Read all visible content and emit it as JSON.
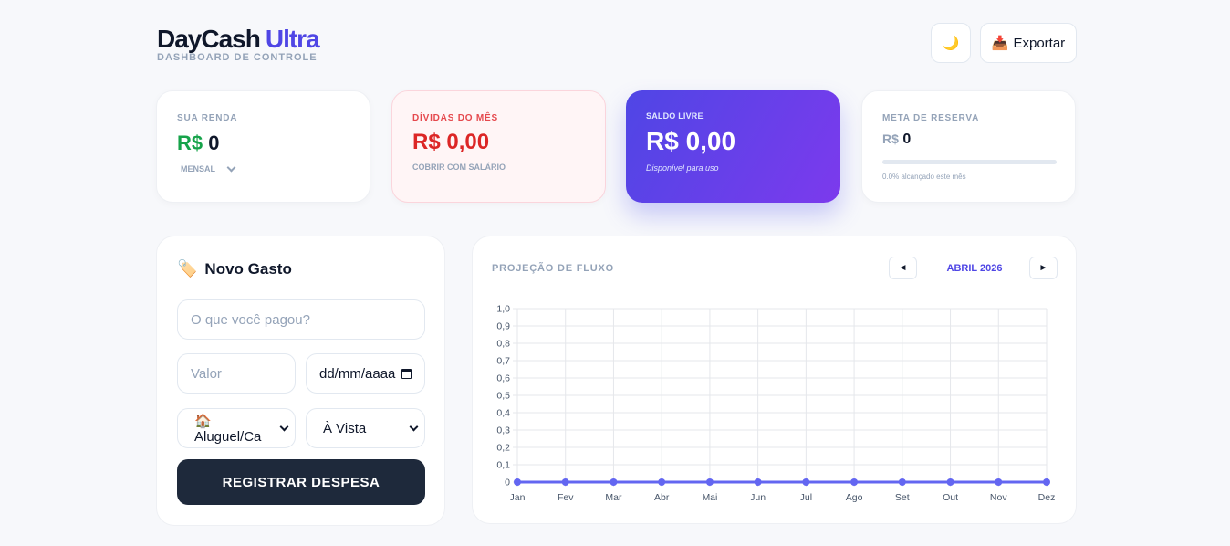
{
  "header": {
    "brand_main": "DayCash",
    "brand_accent": "Ultra",
    "subtitle": "DASHBOARD DE CONTROLE",
    "theme_icon": "🌙",
    "export_icon": "📥",
    "export_label": "Exportar"
  },
  "cards": {
    "renda": {
      "label": "SUA RENDA",
      "currency": "R$",
      "value": "0",
      "frequency": "MENSAL"
    },
    "dividas": {
      "label": "DÍVIDAS DO MÊS",
      "value": "R$ 0,00",
      "note": "COBRIR COM SALÁRIO"
    },
    "saldo": {
      "label": "SALDO LIVRE",
      "value": "R$ 0,00",
      "note": "Disponível para uso"
    },
    "meta": {
      "label": "META DE RESERVA",
      "currency": "R$",
      "value": "0",
      "progress_pct": 0,
      "note": "0.0% alcançado este mês"
    }
  },
  "form": {
    "title": "Novo Gasto",
    "title_icon": "🏷️",
    "description_placeholder": "O que você pagou?",
    "value_placeholder": "Valor",
    "date_value": "dd/mm/aaaa",
    "category_value": "🏠 Aluguel/Ca",
    "payment_value": "À Vista",
    "submit_label": "REGISTRAR DESPESA"
  },
  "chart_panel": {
    "title": "PROJEÇÃO DE FLUXO",
    "month": "ABRIL 2026",
    "prev_symbol": "◄",
    "next_symbol": "►"
  },
  "chart_data": {
    "type": "line",
    "categories": [
      "Jan",
      "Fev",
      "Mar",
      "Abr",
      "Mai",
      "Jun",
      "Jul",
      "Ago",
      "Set",
      "Out",
      "Nov",
      "Dez"
    ],
    "series": [
      {
        "values": [
          0,
          0,
          0,
          0,
          0,
          0,
          0,
          0,
          0,
          0,
          0,
          0
        ],
        "color": "#6366f1"
      }
    ],
    "yticks": [
      "0",
      "0,1",
      "0,2",
      "0,3",
      "0,4",
      "0,5",
      "0,6",
      "0,7",
      "0,8",
      "0,9",
      "1,0"
    ],
    "ylim": [
      0,
      1
    ],
    "grid": true
  }
}
